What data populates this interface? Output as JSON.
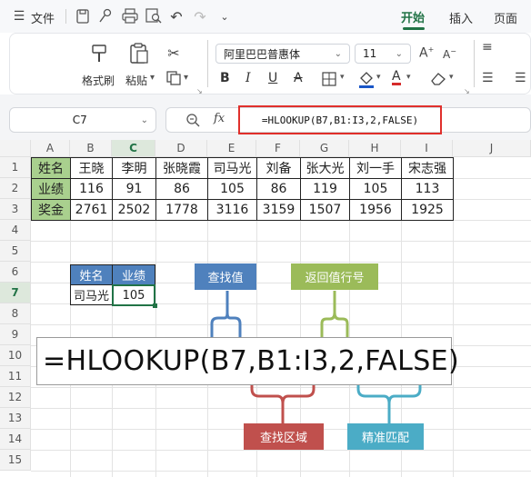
{
  "menu": {
    "file": "文件",
    "tab_home": "开始",
    "tab_insert": "插入",
    "tab_page": "页面"
  },
  "ribbon": {
    "format_painter": "格式刷",
    "paste": "粘贴",
    "font_name": "阿里巴巴普惠体",
    "font_size": "11"
  },
  "formula_bar": {
    "cell_ref": "C7",
    "fx": "fx",
    "formula": "=HLOOKUP(B7,B1:I3,2,FALSE)"
  },
  "columns": [
    "A",
    "B",
    "C",
    "D",
    "E",
    "F",
    "G",
    "H",
    "I",
    "J"
  ],
  "rows": [
    "1",
    "2",
    "3",
    "4",
    "5",
    "6",
    "7",
    "8",
    "9",
    "10",
    "11",
    "12",
    "13",
    "14",
    "15"
  ],
  "table": {
    "row_headers": [
      "姓名",
      "业绩",
      "奖金"
    ],
    "names": [
      "王晓",
      "李明",
      "张晓霞",
      "司马光",
      "刘备",
      "张大光",
      "刘一手",
      "宋志强"
    ],
    "performance": [
      "116",
      "91",
      "86",
      "105",
      "86",
      "119",
      "105",
      "113"
    ],
    "bonus": [
      "2761",
      "2502",
      "1778",
      "3116",
      "3159",
      "1507",
      "1956",
      "1925"
    ]
  },
  "lookup": {
    "h1": "姓名",
    "h2": "业绩",
    "name": "司马光",
    "result": "105"
  },
  "big_formula": "=HLOOKUP(B7,B1:I3,2,FALSE)",
  "annotations": {
    "lookup_value": "查找值",
    "row_index": "返回值行号",
    "range": "查找区域",
    "exact": "精准匹配"
  },
  "colors": {
    "accent": "#217346",
    "blue": "#4f81bd",
    "green": "#a9d08e",
    "olive": "#9bbb59",
    "red": "#c0504d",
    "teal": "#4bacc6"
  }
}
